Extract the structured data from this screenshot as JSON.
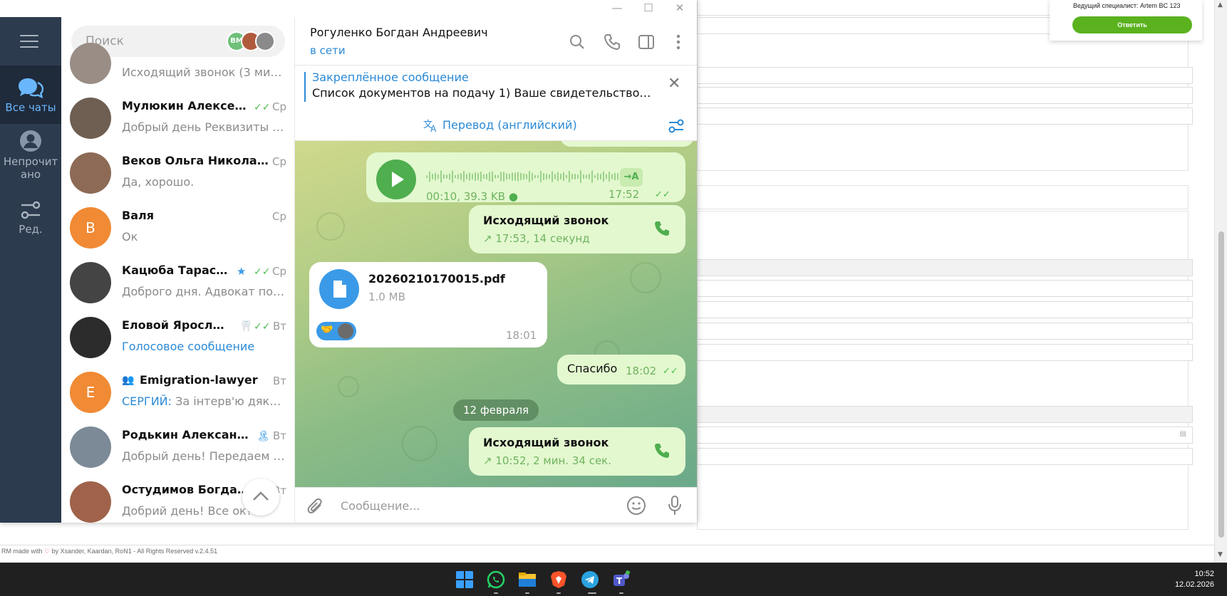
{
  "background": {
    "notification": {
      "assignee": "Ведущий специалист: Artem BC 123",
      "reply_label": "Ответить"
    },
    "footer": {
      "prefix": "RM made with",
      "suffix": "by Xsander, Kaardan, RoN1 - All Rights Reserved v.2.4.51"
    }
  },
  "sidebar_rail": {
    "items": [
      {
        "label": "Все чаты",
        "icon": "chats-icon",
        "active": true
      },
      {
        "label": "Непрочит\nано",
        "icon": "unread-icon",
        "active": false
      },
      {
        "label": "Ред.",
        "icon": "edit-filters-icon",
        "active": false
      }
    ]
  },
  "search": {
    "placeholder": "Поиск",
    "story_avatars": [
      "BM",
      "",
      ""
    ]
  },
  "chats": [
    {
      "name": "",
      "preview": "Исходящий звонок (3 мин. ...",
      "date": "",
      "avatar_color": "#9a8d85"
    },
    {
      "name": "Мулюкин Алексей В...",
      "preview": "Добрый день Реквизиты пе...",
      "date": "Ср",
      "ticks": true,
      "avatar_color": "#6f5f52"
    },
    {
      "name": "Веков Ольга Николаевна",
      "preview": "Да, хорошо.",
      "date": "Ср",
      "avatar_color": "#8c6a55"
    },
    {
      "name": "Валя",
      "preview": "Ок",
      "date": "Ср",
      "avatar_letter": "В",
      "avatar_color": "#f08a34"
    },
    {
      "name": "Кацюба Тарас Бог...",
      "preview": "Доброго дня. Адвокат поду...",
      "date": "Ср",
      "ticks": true,
      "badge": "★",
      "avatar_color": "#444444"
    },
    {
      "name": "Еловой Ярослав ...",
      "preview": "Голосовое сообщение",
      "date": "Вт",
      "ticks": true,
      "badge": "🦷",
      "preview_blue": true,
      "avatar_color": "#2c2c2c"
    },
    {
      "name": "Emigration-lawyer",
      "preview_sender": "СЕРГИЙ:",
      "preview": " За інтерв'ю дякую ...",
      "date": "Вт",
      "avatar_letter": "E",
      "avatar_color": "#f08a34",
      "group": true
    },
    {
      "name": "Родькин Александр ...",
      "preview": "Добрый день!  Передаем ва...",
      "date": "Вт",
      "badge": "🏝",
      "avatar_color": "#7b8a96"
    },
    {
      "name": "Остудимов Богдан А...",
      "preview": "Добрий день! Все ок?",
      "date": "Вт",
      "avatar_color": "#a0624a"
    }
  ],
  "conversation": {
    "title": "Рогуленко Богдан Андреевич",
    "status": "в сети",
    "pinned": {
      "title": "Закреплённое сообщение",
      "text": "Список документов на подачу  1) Ваше свидетельство и с..."
    },
    "translate_label": "Перевод (английский)",
    "messages": {
      "voice": {
        "duration_size": "00:10, 39.3 KB",
        "time": "17:52",
        "transcribe_label": "→A"
      },
      "call1": {
        "title": "Исходящий звонок",
        "meta": "17:53, 14 секунд"
      },
      "file": {
        "name": "20260210170015.pdf",
        "size": "1.0 MB",
        "time": "18:01"
      },
      "thanks": {
        "text": "Спасибо",
        "time": "18:02"
      },
      "date_separator": "12 февраля",
      "call2": {
        "title": "Исходящий звонок",
        "meta": "10:52, 2 мин. 34 сек."
      }
    },
    "composer_placeholder": "Сообщение..."
  },
  "taskbar": {
    "apps": [
      "windows-start",
      "whatsapp",
      "file-explorer",
      "brave",
      "telegram",
      "teams"
    ],
    "time": "10:52",
    "date": "12.02.2026"
  }
}
